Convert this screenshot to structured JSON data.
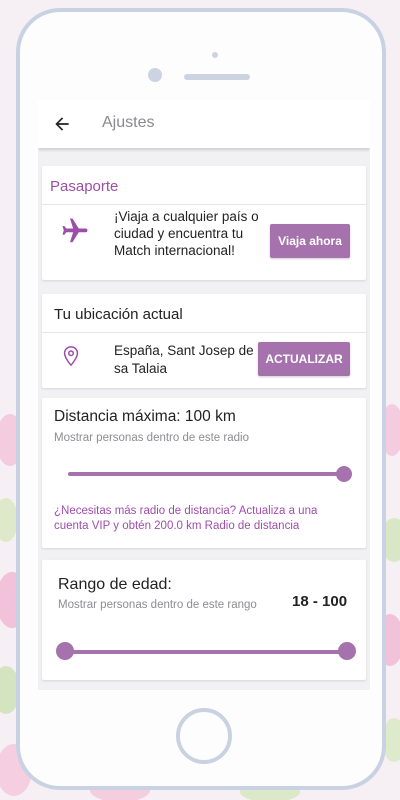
{
  "appbar": {
    "title": "Ajustes"
  },
  "passport": {
    "title": "Pasaporte",
    "description": "¡Viaja a cualquier país o ciudad y encuentra tu Match internacional!",
    "button_label": "Viaja ahora"
  },
  "location": {
    "title": "Tu ubicación actual",
    "value": "España, Sant Josep de sa Talaia",
    "button_label": "ACTUALIZAR"
  },
  "distance": {
    "title": "Distancia máxima: 100 km",
    "subtitle": "Mostrar personas dentro de este radio",
    "slider_value_fraction": 1.0,
    "vip_text": "¿Necesitas más radio de distancia? Actualiza a una cuenta VIP y obtén 200.0 km Radio de distancia"
  },
  "age": {
    "title": "Rango de edad:",
    "subtitle": "Mostrar personas dentro de este rango",
    "range_label": "18 - 100",
    "min_fraction": 0.0,
    "max_fraction": 1.0
  },
  "colors": {
    "accent": "#a672ae",
    "accent_text": "#9b4fa6"
  },
  "icons": [
    "back-arrow-icon",
    "plane-icon",
    "location-pin-icon"
  ]
}
